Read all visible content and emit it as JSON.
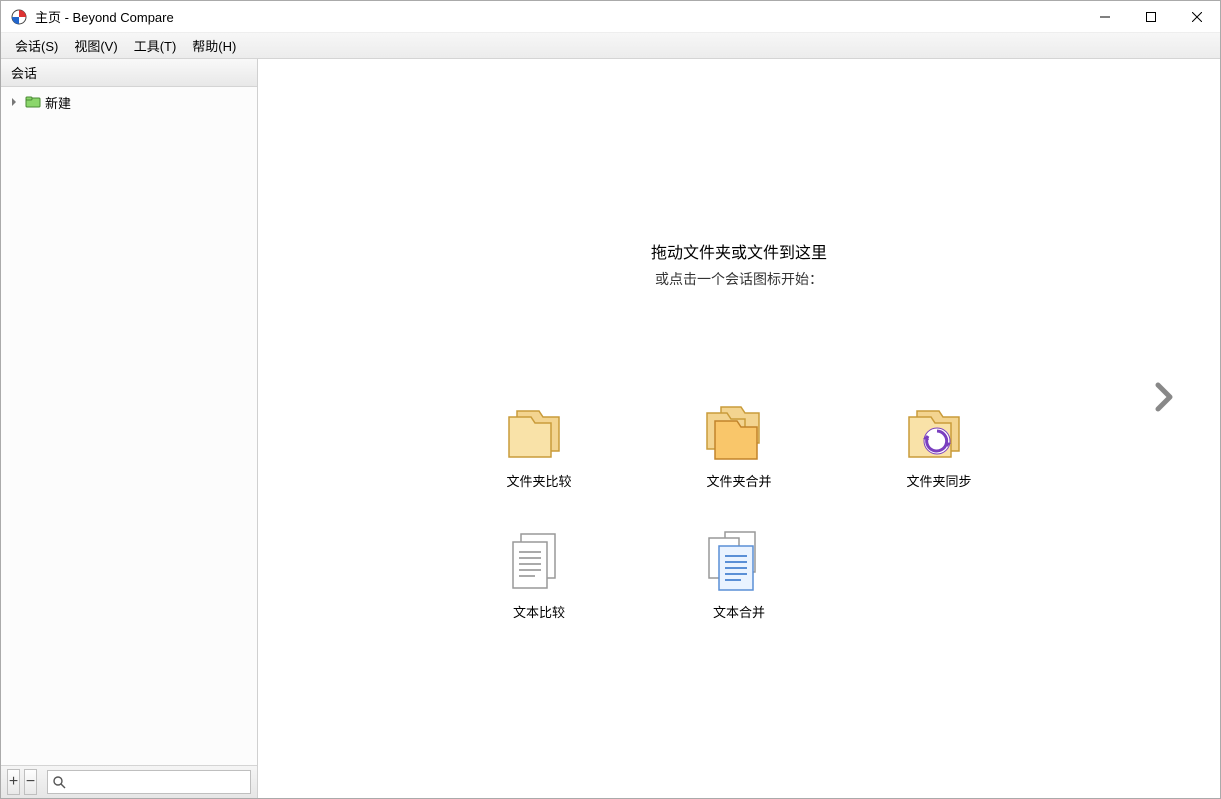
{
  "window": {
    "title": "主页 - Beyond Compare"
  },
  "menu": {
    "session": "会话(S)",
    "view": "视图(V)",
    "tools": "工具(T)",
    "help": "帮助(H)"
  },
  "sidebar": {
    "header": "会话",
    "tree": {
      "new_label": "新建"
    },
    "footer": {
      "add": "+",
      "remove": "−",
      "search_placeholder": ""
    }
  },
  "main": {
    "prompt_line1": "拖动文件夹或文件到这里",
    "prompt_line2": "或点击一个会话图标开始：",
    "items": {
      "folder_compare": "文件夹比较",
      "folder_merge": "文件夹合并",
      "folder_sync": "文件夹同步",
      "text_compare": "文本比较",
      "text_merge": "文本合并"
    }
  }
}
